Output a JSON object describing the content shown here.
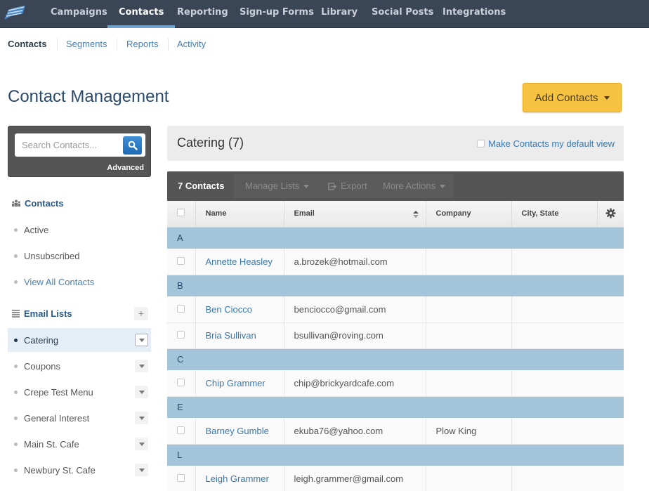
{
  "topnav": {
    "logo_icon": "flag-logo-icon",
    "items": [
      {
        "label": "Campaigns",
        "active": false
      },
      {
        "label": "Contacts",
        "active": true
      },
      {
        "label": "Reporting",
        "active": false
      },
      {
        "label": "Sign-up Forms",
        "active": false
      },
      {
        "label": "Library",
        "active": false
      },
      {
        "label": "Social Posts",
        "active": false
      },
      {
        "label": "Integrations",
        "active": false
      }
    ]
  },
  "subnav": {
    "items": [
      {
        "label": "Contacts",
        "active": true
      },
      {
        "label": "Segments",
        "active": false
      },
      {
        "label": "Reports",
        "active": false
      },
      {
        "label": "Activity",
        "active": false
      }
    ]
  },
  "page_title": "Contact Management",
  "add_contacts_label": "Add Contacts",
  "search": {
    "placeholder": "Search Contacts...",
    "value": "",
    "advanced_label": "Advanced"
  },
  "sidebar": {
    "contacts_header": "Contacts",
    "contacts_items": [
      {
        "label": "Active"
      },
      {
        "label": "Unsubscribed"
      },
      {
        "label": "View All Contacts"
      }
    ],
    "email_lists_header": "Email Lists",
    "add_list_label": "+",
    "email_lists": [
      {
        "label": "Catering",
        "active": true
      },
      {
        "label": "Coupons",
        "active": false
      },
      {
        "label": "Crepe Test Menu",
        "active": false
      },
      {
        "label": "General Interest",
        "active": false
      },
      {
        "label": "Main St. Cafe",
        "active": false
      },
      {
        "label": "Newbury St. Cafe",
        "active": false
      }
    ]
  },
  "list": {
    "title": "Catering (7)",
    "default_view_label": "Make Contacts my default view",
    "default_view_checked": false
  },
  "toolbar": {
    "count": "7 Contacts",
    "manage_lists": "Manage Lists",
    "export": "Export",
    "more_actions": "More Actions"
  },
  "table": {
    "columns": [
      "Name",
      "Email",
      "Company",
      "City, State"
    ],
    "groups": [
      {
        "letter": "A",
        "rows": [
          {
            "name": "Annette Heasley",
            "email": "a.brozek@hotmail.com",
            "company": "",
            "city": ""
          }
        ]
      },
      {
        "letter": "B",
        "rows": [
          {
            "name": "Ben Ciocco",
            "email": "benciocco@gmail.com",
            "company": "",
            "city": ""
          },
          {
            "name": "Bria Sullivan",
            "email": "bsullivan@roving.com",
            "company": "",
            "city": ""
          }
        ]
      },
      {
        "letter": "C",
        "rows": [
          {
            "name": "Chip Grammer",
            "email": "chip@brickyardcafe.com",
            "company": "",
            "city": ""
          }
        ]
      },
      {
        "letter": "E",
        "rows": [
          {
            "name": "Barney Gumble",
            "email": "ekuba76@yahoo.com",
            "company": "Plow King",
            "city": ""
          }
        ]
      },
      {
        "letter": "L",
        "rows": [
          {
            "name": "Leigh Grammer",
            "email": "leigh.grammer@gmail.com",
            "company": "",
            "city": ""
          }
        ]
      }
    ]
  },
  "colors": {
    "nav_bg": "#3a4556",
    "accent_blue": "#3a78b0",
    "add_button": "#f5c242",
    "group_row": "#a3c4d9",
    "toolbar_bg": "#555555"
  }
}
